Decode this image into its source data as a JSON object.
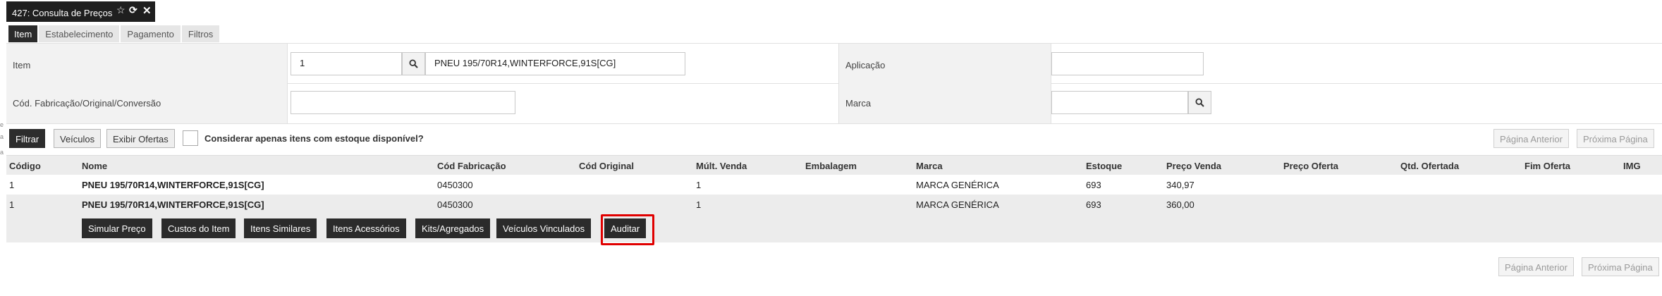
{
  "window_tab": {
    "title": "427: Consulta de Preços"
  },
  "sub_tabs": [
    "Item",
    "Estabelecimento",
    "Pagamento",
    "Filtros"
  ],
  "form": {
    "item_label": "Item",
    "item_code": "1",
    "item_description": "PNEU 195/70R14,WINTERFORCE,91S[CG]",
    "aplicacao_label": "Aplicação",
    "aplicacao_value": "",
    "cod_fabricacao_label": "Cód. Fabricação/Original/Conversão",
    "cod_fabricacao_value": "",
    "marca_label": "Marca",
    "marca_value": ""
  },
  "toolbar": {
    "filtrar": "Filtrar",
    "veiculos": "Veículos",
    "exibir_ofertas": "Exibir Ofertas",
    "estoque_checkbox_label": "Considerar apenas itens com estoque disponível?",
    "pagina_anterior": "Página Anterior",
    "proxima_pagina": "Próxima Página"
  },
  "table": {
    "columns": [
      "Código",
      "Nome",
      "Cód Fabricação",
      "Cód Original",
      "Múlt. Venda",
      "Embalagem",
      "Marca",
      "Estoque",
      "Preço Venda",
      "Preço Oferta",
      "Qtd. Ofertada",
      "Fim Oferta",
      "IMG"
    ],
    "rows": [
      {
        "codigo": "1",
        "nome": "PNEU 195/70R14,WINTERFORCE,91S[CG]",
        "cod_fabricacao": "0450300",
        "cod_original": "",
        "mult_venda": "1",
        "embalagem": "",
        "marca": "MARCA GENÉRICA",
        "estoque": "693",
        "preco_venda": "340,97",
        "preco_oferta": "",
        "qtd_ofertada": "",
        "fim_oferta": "",
        "img": ""
      },
      {
        "codigo": "1",
        "nome": "PNEU 195/70R14,WINTERFORCE,91S[CG]",
        "cod_fabricacao": "0450300",
        "cod_original": "",
        "mult_venda": "1",
        "embalagem": "",
        "marca": "MARCA GENÉRICA",
        "estoque": "693",
        "preco_venda": "360,00",
        "preco_oferta": "",
        "qtd_ofertada": "",
        "fim_oferta": "",
        "img": ""
      }
    ]
  },
  "row_actions": [
    "Simular Preço",
    "Custos do Item",
    "Itens Similares",
    "Itens Acessórios",
    "Kits/Agregados",
    "Veículos Vinculados",
    "Auditar"
  ],
  "footer": {
    "pagina_anterior": "Página Anterior",
    "proxima_pagina": "Próxima Página"
  },
  "left_edge_glyphs": [
    "e",
    "a",
    "a"
  ],
  "colors": {
    "highlight": "#e00000",
    "dark_button": "#2b2b2b"
  }
}
